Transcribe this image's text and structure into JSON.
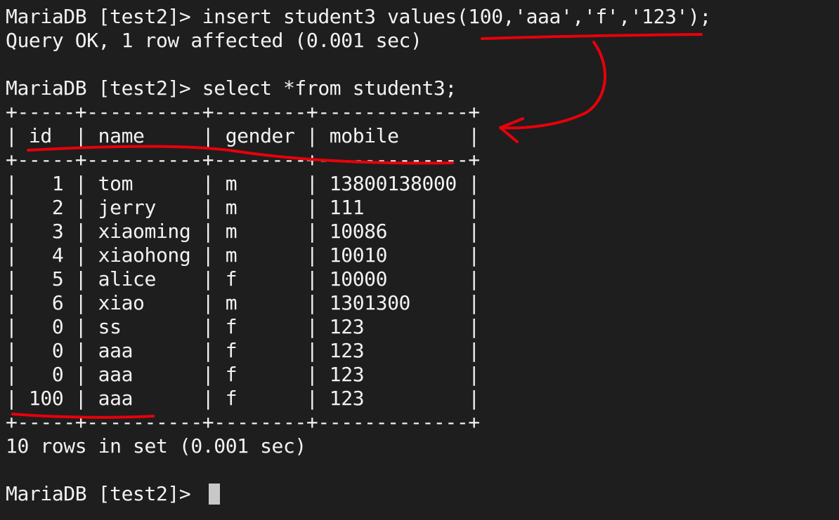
{
  "terminal": {
    "lines": [
      "MariaDB [test2]> insert student3 values(100,'aaa','f','123');",
      "Query OK, 1 row affected (0.001 sec)",
      "",
      "MariaDB [test2]> select *from student3;",
      "+-----+----------+--------+-------------+",
      "| id  | name     | gender | mobile      |",
      "+-----+----------+--------+-------------+",
      "|   1 | tom      | m      | 13800138000 |",
      "|   2 | jerry    | m      | 111         |",
      "|   3 | xiaoming | m      | 10086       |",
      "|   4 | xiaohong | m      | 10010       |",
      "|   5 | alice    | f      | 10000       |",
      "|   6 | xiao     | m      | 1301300     |",
      "|   0 | ss       | f      | 123         |",
      "|   0 | aaa      | f      | 123         |",
      "|   0 | aaa      | f      | 123         |",
      "| 100 | aaa      | f      | 123         |",
      "+-----+----------+--------+-------------+",
      "10 rows in set (0.001 sec)",
      "",
      "MariaDB [test2]> "
    ]
  },
  "colors": {
    "background": "#1e1e1e",
    "text": "#f2f2f2",
    "cursor": "#c8c8c8",
    "annotation": "#e8000b"
  }
}
